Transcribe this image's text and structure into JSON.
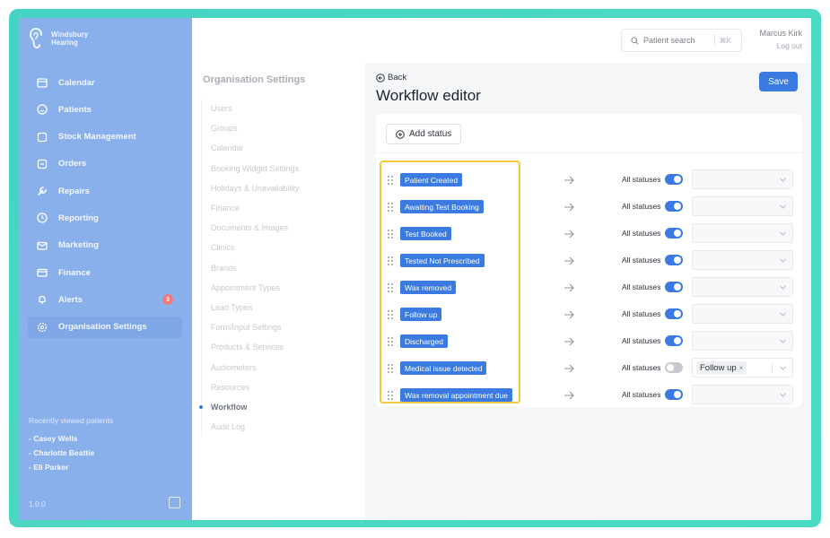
{
  "brand": {
    "line1": "Windsbury",
    "line2": "Hearing"
  },
  "sidebar": {
    "items": [
      {
        "label": "Calendar",
        "icon": "calendar-icon"
      },
      {
        "label": "Patients",
        "icon": "smile-icon"
      },
      {
        "label": "Stock Management",
        "icon": "box-icon"
      },
      {
        "label": "Orders",
        "icon": "orders-icon"
      },
      {
        "label": "Repairs",
        "icon": "wrench-icon"
      },
      {
        "label": "Reporting",
        "icon": "clock-icon"
      },
      {
        "label": "Marketing",
        "icon": "mail-icon"
      },
      {
        "label": "Finance",
        "icon": "card-icon"
      },
      {
        "label": "Alerts",
        "icon": "bell-icon",
        "badge": "3"
      },
      {
        "label": "Organisation Settings",
        "icon": "gear-icon",
        "active": true
      }
    ],
    "recent_title": "Recently viewed patients",
    "recent": [
      "- Casey Wells",
      "- Charlotte Beattie",
      "- Eli Parker"
    ],
    "version": "1.0.0"
  },
  "topbar": {
    "search_placeholder": "Patient search",
    "search_shortcut": "⌘K",
    "user_name": "Marcus Kirk",
    "logout": "Log out"
  },
  "settings": {
    "title": "Organisation Settings",
    "items": [
      "Users",
      "Groups",
      "Calendar",
      "Booking Widget Settings",
      "Holidays & Unavailability",
      "Finance",
      "Documents & Images",
      "Clinics",
      "Brands",
      "Appointment Types",
      "Lead Types",
      "Form/Input Settings",
      "Products & Services",
      "Audiometers",
      "Resources",
      "Workflow",
      "Audit Log"
    ],
    "active": "Workflow"
  },
  "main": {
    "back": "Back",
    "title": "Workflow editor",
    "save": "Save",
    "add_status": "Add status",
    "all_statuses": "All statuses",
    "rows": [
      {
        "status": "Patient Created",
        "all": true,
        "target": ""
      },
      {
        "status": "Awaiting Test Booking",
        "all": true,
        "target": ""
      },
      {
        "status": "Test Booked",
        "all": true,
        "target": ""
      },
      {
        "status": "Tested Not Prescribed",
        "all": true,
        "target": ""
      },
      {
        "status": "Wax removed",
        "all": true,
        "target": ""
      },
      {
        "status": "Follow up",
        "all": true,
        "target": ""
      },
      {
        "status": "Discharged",
        "all": true,
        "target": ""
      },
      {
        "status": "Medical issue detected",
        "all": false,
        "target": "Follow up"
      },
      {
        "status": "Wax removal appointment due",
        "all": true,
        "target": ""
      }
    ]
  },
  "colors": {
    "accent": "#3b7ae0",
    "sidebar": "#8ab0ec",
    "frame": "#45d3c4",
    "highlight": "#f6c83b"
  }
}
